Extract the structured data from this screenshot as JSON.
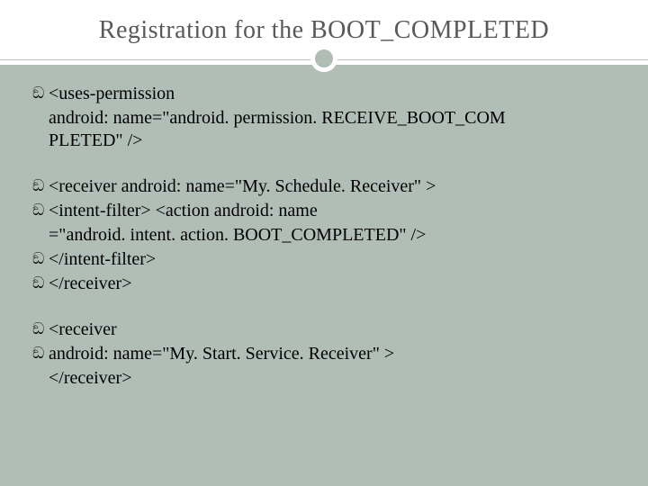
{
  "title": "Registration for the BOOT_COMPLETED",
  "block1": {
    "l1": "<uses-permission",
    "l1b": "android: name=\"android. permission. RECEIVE_BOOT_COM",
    "l1c": "PLETED\" />"
  },
  "block2": {
    "l1": "<receiver android: name=\"My. Schedule. Receiver\" >",
    "l2": " <intent-filter> <action android: name",
    "l2b": "=\"android. intent. action. BOOT_COMPLETED\" />",
    "l3": " </intent-filter>",
    "l4": "</receiver>"
  },
  "block3": {
    "l1": "<receiver",
    "l2": " android: name=\"My. Start. Service. Receiver\" >",
    "l2b": "</receiver>"
  },
  "glyph": "ඞ"
}
